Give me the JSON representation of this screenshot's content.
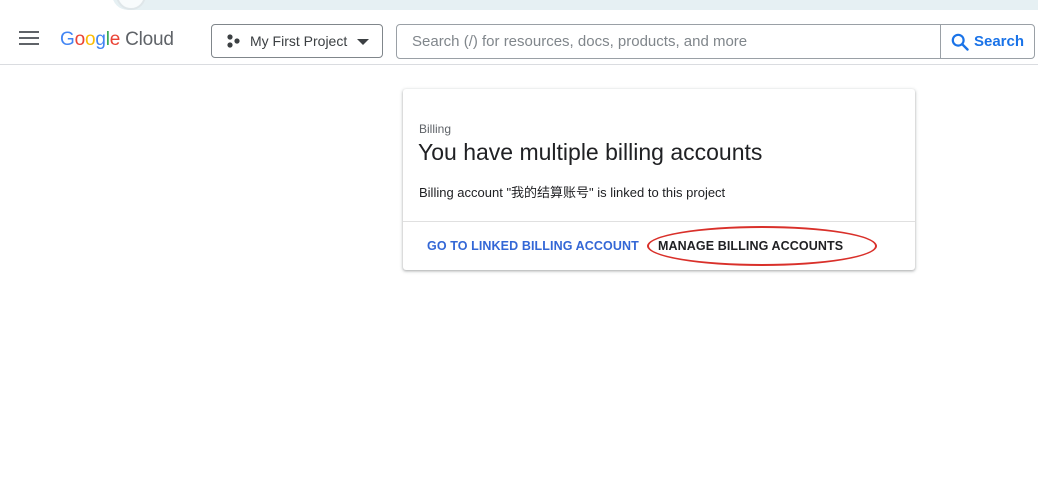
{
  "header": {
    "logo_google": [
      "G",
      "o",
      "o",
      "g",
      "l",
      "e"
    ],
    "logo_cloud": "Cloud",
    "project_name": "My First Project",
    "search": {
      "placeholder": "Search (/) for resources, docs, products, and more",
      "value": "",
      "button_label": "Search"
    }
  },
  "card": {
    "eyebrow": "Billing",
    "title": "You have multiple billing accounts",
    "description": "Billing account \"我的结算账号\" is linked to this project",
    "actions": {
      "go_to_linked": "GO TO LINKED BILLING ACCOUNT",
      "manage": "MANAGE BILLING ACCOUNTS"
    }
  },
  "icons": {
    "menu": "hamburger-menu-icon",
    "project": "project-dots-icon",
    "caret": "caret-down-icon",
    "search": "search-icon"
  },
  "colors": {
    "accent": "#1a73e8",
    "link": "#3367d6",
    "annotation": "#d9302a"
  }
}
